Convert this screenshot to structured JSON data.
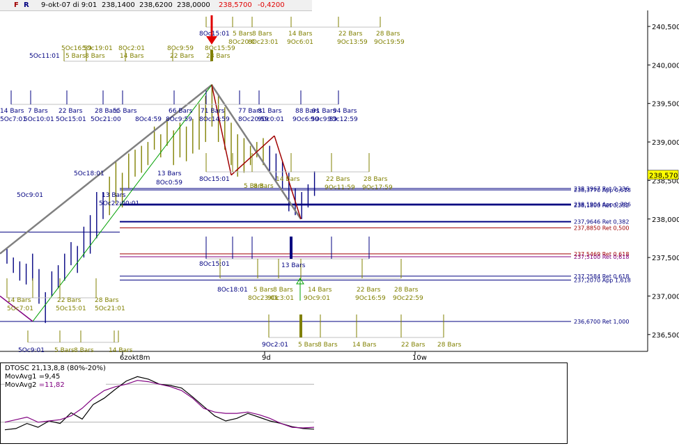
{
  "toolbar": {
    "btn_f": "F",
    "btn_r": "R",
    "datetime": "9-okt-07 di 9:01",
    "open": "238,1400",
    "high": "238,6200",
    "low": "238,0000",
    "close": "238,5700",
    "change": "-0,4200"
  },
  "colors": {
    "navy": "#000080",
    "olive": "#808000",
    "purple": "#800080",
    "red": "#e00000",
    "dark_red": "#a00000",
    "green": "#00a000",
    "gray": "#808080",
    "price_tag": "#ffff00"
  },
  "chart_data": [
    {
      "type": "line",
      "ylim": [
        236.3,
        240.7
      ],
      "grid": true,
      "y_ticks": [
        "240,500",
        "240,000",
        "239,500",
        "239,000",
        "238,500",
        "238,000",
        "237,500",
        "237,000",
        "236,500"
      ],
      "last_price_label": "238,570",
      "x_tick_labels": [
        "6zokt8m",
        "9d",
        "10w"
      ],
      "price_bars": [
        [
          237.42,
          237.62
        ],
        [
          237.3,
          237.5
        ],
        [
          237.2,
          237.45
        ],
        [
          237.15,
          237.42
        ],
        [
          237.2,
          237.55
        ],
        [
          236.9,
          237.35
        ],
        [
          236.65,
          237.05
        ],
        [
          237.0,
          237.32
        ],
        [
          237.1,
          237.4
        ],
        [
          237.2,
          237.55
        ],
        [
          237.4,
          237.7
        ],
        [
          237.3,
          237.65
        ],
        [
          237.5,
          237.9
        ],
        [
          237.55,
          238.05
        ],
        [
          237.75,
          238.35
        ],
        [
          238.0,
          238.35
        ],
        [
          238.05,
          238.55
        ],
        [
          238.2,
          238.75
        ],
        [
          238.15,
          238.6
        ],
        [
          238.4,
          238.85
        ],
        [
          238.55,
          238.9
        ],
        [
          238.6,
          238.95
        ],
        [
          238.7,
          239.0
        ],
        [
          238.9,
          239.2
        ],
        [
          238.8,
          239.1
        ],
        [
          238.95,
          239.3
        ],
        [
          238.7,
          239.15
        ],
        [
          238.8,
          239.25
        ],
        [
          238.75,
          239.2
        ],
        [
          238.85,
          239.3
        ],
        [
          238.9,
          239.5
        ],
        [
          239.0,
          239.6
        ],
        [
          239.2,
          239.75
        ],
        [
          239.0,
          239.6
        ],
        [
          238.9,
          239.45
        ],
        [
          238.7,
          239.25
        ],
        [
          238.55,
          239.1
        ],
        [
          238.6,
          239.05
        ],
        [
          238.7,
          238.95
        ],
        [
          238.8,
          239.0
        ],
        [
          238.7,
          239.05
        ],
        [
          238.6,
          238.95
        ],
        [
          238.5,
          238.85
        ],
        [
          238.4,
          238.75
        ],
        [
          238.1,
          238.6
        ],
        [
          238.05,
          238.4
        ],
        [
          238.0,
          238.35
        ],
        [
          238.15,
          238.45
        ],
        [
          238.3,
          238.62
        ]
      ],
      "fib_lines": [
        {
          "y": 238.3967,
          "label": "238,3967 Ret 0,236",
          "color": "navy"
        },
        {
          "y": 238.377,
          "label": "238,3770 App 0,618",
          "color": "navy"
        },
        {
          "y": 238.1904,
          "label": "238,1904 App 0,786",
          "color": "navy"
        },
        {
          "y": 238.18,
          "label": "238,1800 Ret 0,382",
          "color": "navy"
        },
        {
          "y": 237.9646,
          "label": "237,9646 Ret 0,382",
          "color": "navy"
        },
        {
          "y": 237.885,
          "label": "237,8850 Ret 0,500",
          "color": "dark_red"
        },
        {
          "y": 237.5469,
          "label": "237,5469 Ret 0,618",
          "color": "dark_red"
        },
        {
          "y": 237.51,
          "label": "237,5100 Ret 0,618",
          "color": "purple"
        },
        {
          "y": 237.2584,
          "label": "237,2584 Ret 0,618",
          "color": "navy"
        },
        {
          "y": 237.207,
          "label": "237,2070 App 1,618",
          "color": "navy"
        },
        {
          "y": 236.67,
          "label": "236,6700 Ret 1,000",
          "color": "navy"
        }
      ],
      "time_labels": [
        {
          "text": "8Oc15:01",
          "color": "navy"
        },
        {
          "text": "5 Bars",
          "color": "olive"
        },
        {
          "text": "8 Bars",
          "color": "olive"
        },
        {
          "text": "14 Bars",
          "color": "olive"
        },
        {
          "text": "22 Bars",
          "color": "olive"
        },
        {
          "text": "28 Bars",
          "color": "olive"
        },
        {
          "text": "8Oc20:0",
          "color": "olive"
        },
        {
          "text": "8Oc23:01",
          "color": "olive"
        },
        {
          "text": "9Oc6:01",
          "color": "olive"
        },
        {
          "text": "9Oc13:59",
          "color": "olive"
        },
        {
          "text": "9Oc19:59",
          "color": "olive"
        },
        {
          "text": "5Oc16:59",
          "color": "olive"
        },
        {
          "text": "5Oc19:01",
          "color": "olive"
        },
        {
          "text": "8Oc2:01",
          "color": "olive"
        },
        {
          "text": "8Oc9:59",
          "color": "olive"
        },
        {
          "text": "8Oc15:59",
          "color": "olive"
        },
        {
          "text": "5Oc11:01",
          "color": "navy"
        },
        {
          "text": "5 Bars",
          "color": "olive"
        },
        {
          "text": "8 Bars",
          "color": "olive"
        },
        {
          "text": "14 Bars",
          "color": "olive"
        },
        {
          "text": "22 Bars",
          "color": "olive"
        },
        {
          "text": "28 Bars",
          "color": "olive"
        },
        {
          "text": "14 Bars",
          "color": "navy"
        },
        {
          "text": "7 Bars",
          "color": "navy"
        },
        {
          "text": "22 Bars",
          "color": "navy"
        },
        {
          "text": "28 Bars",
          "color": "navy"
        },
        {
          "text": "55 Bars",
          "color": "navy"
        },
        {
          "text": "66 Bars",
          "color": "navy"
        },
        {
          "text": "71 Bars",
          "color": "navy"
        },
        {
          "text": "77 Bars",
          "color": "navy"
        },
        {
          "text": "81 Bars",
          "color": "navy"
        },
        {
          "text": "88 Bars",
          "color": "navy"
        },
        {
          "text": "91 Bars",
          "color": "navy"
        },
        {
          "text": "94 Bars",
          "color": "navy"
        },
        {
          "text": "5Oc7:01",
          "color": "navy"
        },
        {
          "text": "5Oc10:01",
          "color": "navy"
        },
        {
          "text": "5Oc15:01",
          "color": "navy"
        },
        {
          "text": "5Oc21:00",
          "color": "navy"
        },
        {
          "text": "8Oc4:59",
          "color": "navy"
        },
        {
          "text": "8Oc9:59",
          "color": "navy"
        },
        {
          "text": "8Oc14:59",
          "color": "navy"
        },
        {
          "text": "8Oc20:59",
          "color": "navy"
        },
        {
          "text": "9Oc0:01",
          "color": "navy"
        },
        {
          "text": "9Oc6:59",
          "color": "navy"
        },
        {
          "text": "9Oc9:59",
          "color": "navy"
        },
        {
          "text": "9Oc12:59",
          "color": "navy"
        },
        {
          "text": "5Oc18:01",
          "color": "navy"
        },
        {
          "text": "13 Bars",
          "color": "navy"
        },
        {
          "text": "8Oc0:59",
          "color": "navy"
        },
        {
          "text": "5Oc9:01",
          "color": "navy"
        },
        {
          "text": "13 Bars",
          "color": "navy"
        },
        {
          "text": "5Oc22:00:01",
          "color": "navy"
        },
        {
          "text": "8Oc15:01",
          "color": "navy"
        },
        {
          "text": "5 Bars",
          "color": "olive"
        },
        {
          "text": "8 Bars",
          "color": "olive"
        },
        {
          "text": "14 Bars",
          "color": "olive"
        },
        {
          "text": "22 Bars",
          "color": "olive"
        },
        {
          "text": "28 Bars",
          "color": "olive"
        },
        {
          "text": "9Oc11:59",
          "color": "olive"
        },
        {
          "text": "9Oc17:59",
          "color": "olive"
        },
        {
          "text": "14 Bars",
          "color": "olive"
        },
        {
          "text": "22 Bars",
          "color": "olive"
        },
        {
          "text": "28 Bars",
          "color": "olive"
        },
        {
          "text": "5Oc7:01",
          "color": "olive"
        },
        {
          "text": "5Oc15:01",
          "color": "olive"
        },
        {
          "text": "5Oc21:01",
          "color": "olive"
        },
        {
          "text": "8Oc15:01",
          "color": "navy"
        },
        {
          "text": "13 Bars",
          "color": "navy"
        },
        {
          "text": "8Oc18:01",
          "color": "navy"
        },
        {
          "text": "5 Bars",
          "color": "olive"
        },
        {
          "text": "8 Bars",
          "color": "olive"
        },
        {
          "text": "14 Bars",
          "color": "olive"
        },
        {
          "text": "22 Bars",
          "color": "olive"
        },
        {
          "text": "28 Bars",
          "color": "olive"
        },
        {
          "text": "8Oc23:01",
          "color": "olive"
        },
        {
          "text": "9Oc3:01",
          "color": "olive"
        },
        {
          "text": "9Oc9:01",
          "color": "olive"
        },
        {
          "text": "9Oc16:59",
          "color": "olive"
        },
        {
          "text": "9Oc22:59",
          "color": "olive"
        },
        {
          "text": "9Oc2:01",
          "color": "navy"
        },
        {
          "text": "5 Bars",
          "color": "olive"
        },
        {
          "text": "8 Bars",
          "color": "olive"
        },
        {
          "text": "14 Bars",
          "color": "olive"
        },
        {
          "text": "22 Bars",
          "color": "olive"
        },
        {
          "text": "28 Bars",
          "color": "olive"
        },
        {
          "text": "5Oc9:01",
          "color": "navy"
        },
        {
          "text": "5 Bars",
          "color": "olive"
        },
        {
          "text": "8 Bars",
          "color": "olive"
        },
        {
          "text": "14 Bars",
          "color": "olive"
        }
      ]
    },
    {
      "type": "line",
      "title": "DTOSC 21,13,8,8 (80%-20%)",
      "ylim": [
        0,
        100
      ],
      "levels": [
        80,
        20
      ],
      "series": [
        {
          "name": "MovAvg1",
          "value_label": "=9,45",
          "color": "black",
          "values": [
            8,
            10,
            18,
            12,
            22,
            18,
            35,
            25,
            48,
            58,
            72,
            85,
            92,
            88,
            80,
            78,
            74,
            60,
            45,
            30,
            22,
            26,
            34,
            28,
            22,
            18,
            13,
            10,
            9
          ]
        },
        {
          "name": "MovAvg2",
          "value_label": "=11,82",
          "color": "purple",
          "values": [
            20,
            24,
            28,
            20,
            22,
            24,
            30,
            42,
            58,
            70,
            76,
            80,
            86,
            84,
            80,
            76,
            70,
            58,
            42,
            36,
            34,
            34,
            36,
            32,
            26,
            18,
            12,
            11,
            12
          ]
        }
      ]
    }
  ]
}
